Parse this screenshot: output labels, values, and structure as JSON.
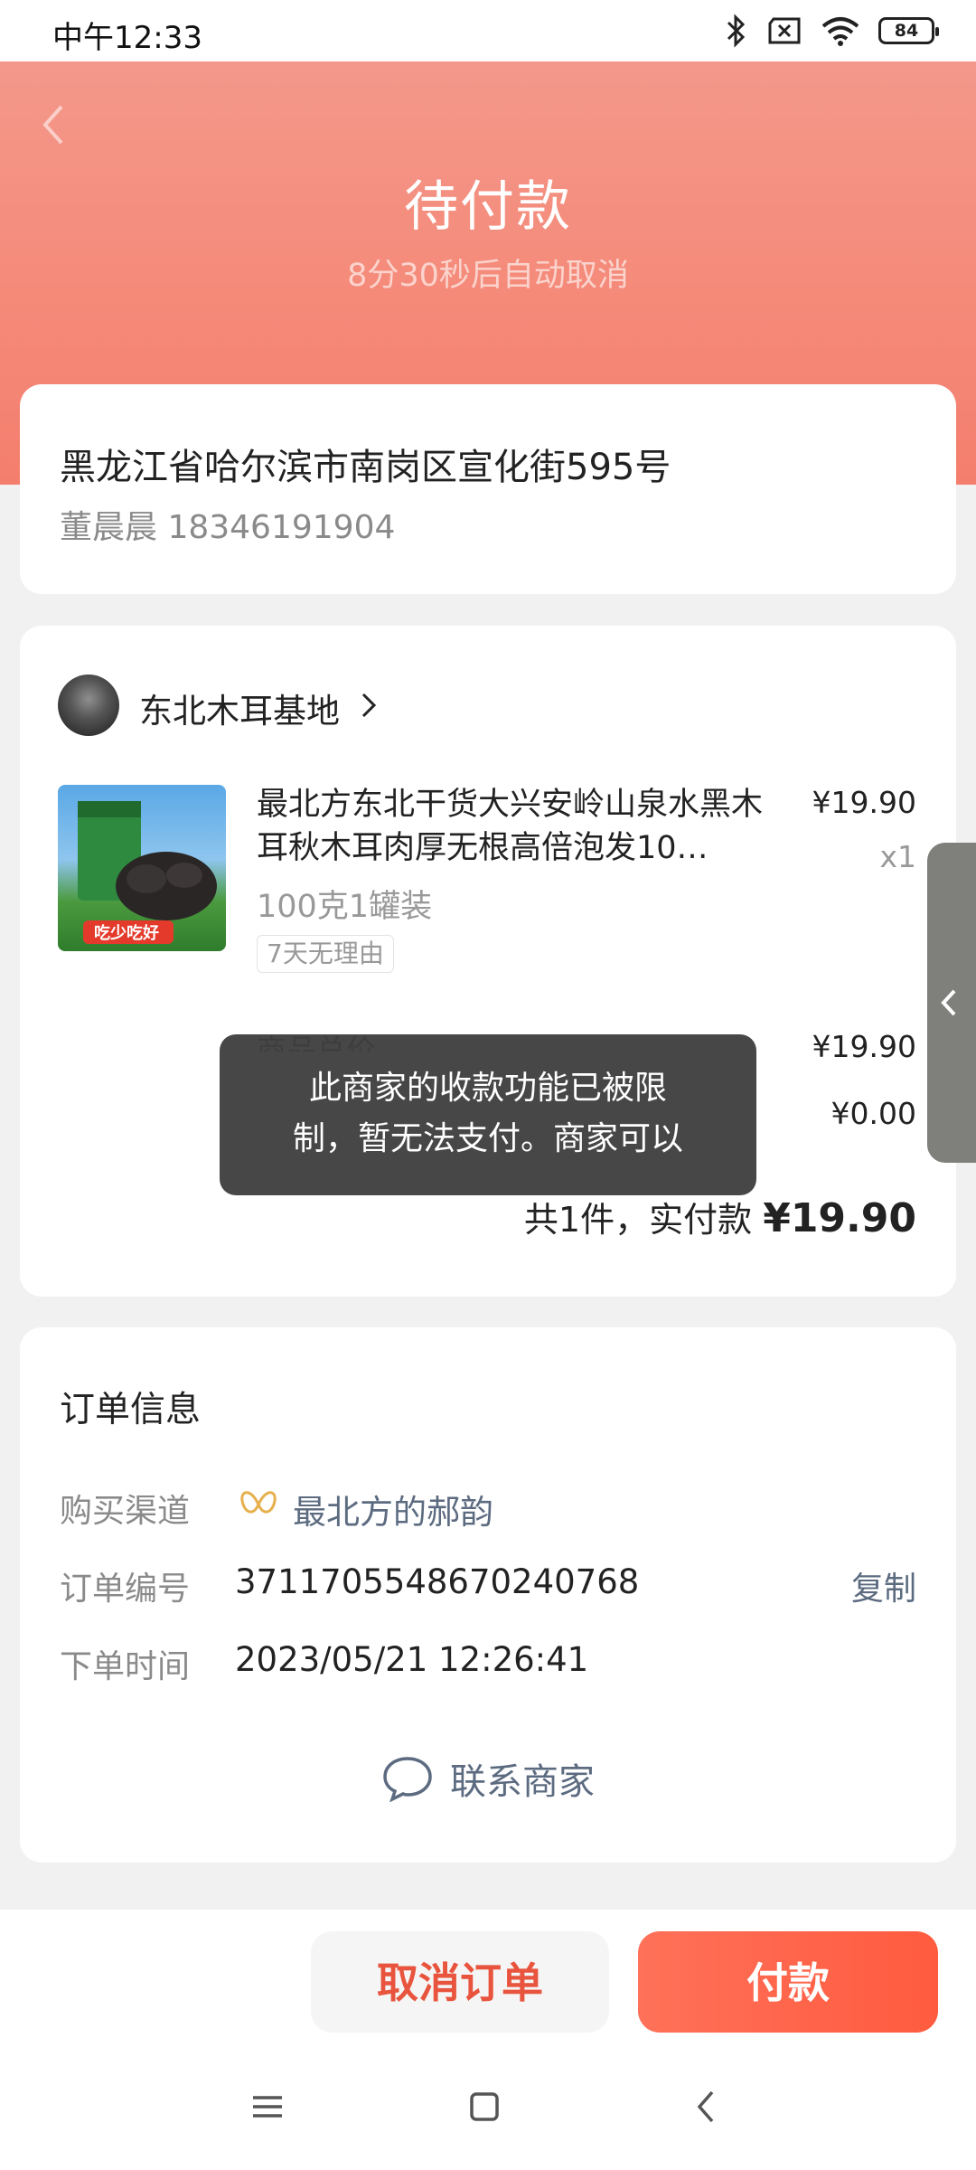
{
  "status_bar": {
    "time": "中午12:33",
    "battery": "84",
    "icons": [
      "bluetooth-icon",
      "no-sim-icon",
      "wifi-icon",
      "battery-icon"
    ]
  },
  "header": {
    "title": "待付款",
    "countdown": "8分30秒后自动取消"
  },
  "address": {
    "line": "黑龙江省哈尔滨市南岗区宣化街595号",
    "contact": "董晨晨 18346191904"
  },
  "shop": {
    "name": "东北木耳基地"
  },
  "product": {
    "title": "最北方东北干货大兴安岭山泉水黑木耳秋木耳肉厚无根高倍泡发10…",
    "price": "¥19.90",
    "qty": "x1",
    "spec": "100克1罐装",
    "tag": "7天无理由",
    "image_caption": "吃少吃好"
  },
  "summary": {
    "subtotal_label_partial": "商品总价",
    "subtotal": "¥19.90",
    "shipping": "¥0.00",
    "total_prefix": "共1件，实付款",
    "total_amount": "¥19.90"
  },
  "toast": {
    "line1": "此商家的收款功能已被限",
    "line2": "制，暂无法支付。商家可以"
  },
  "order_info": {
    "title": "订单信息",
    "channel_label": "购买渠道",
    "channel_value": "最北方的郝韵",
    "number_label": "订单编号",
    "number_value": "3711705548670240768",
    "copy": "复制",
    "time_label": "下单时间",
    "time_value": "2023/05/21 12:26:41",
    "contact_merchant": "联系商家"
  },
  "actions": {
    "cancel": "取消订单",
    "pay": "付款"
  },
  "colors": {
    "header_top": "#f3988b",
    "accent": "#ff5b3f",
    "cancel_text": "#e8543d",
    "link": "#5c6b80"
  }
}
